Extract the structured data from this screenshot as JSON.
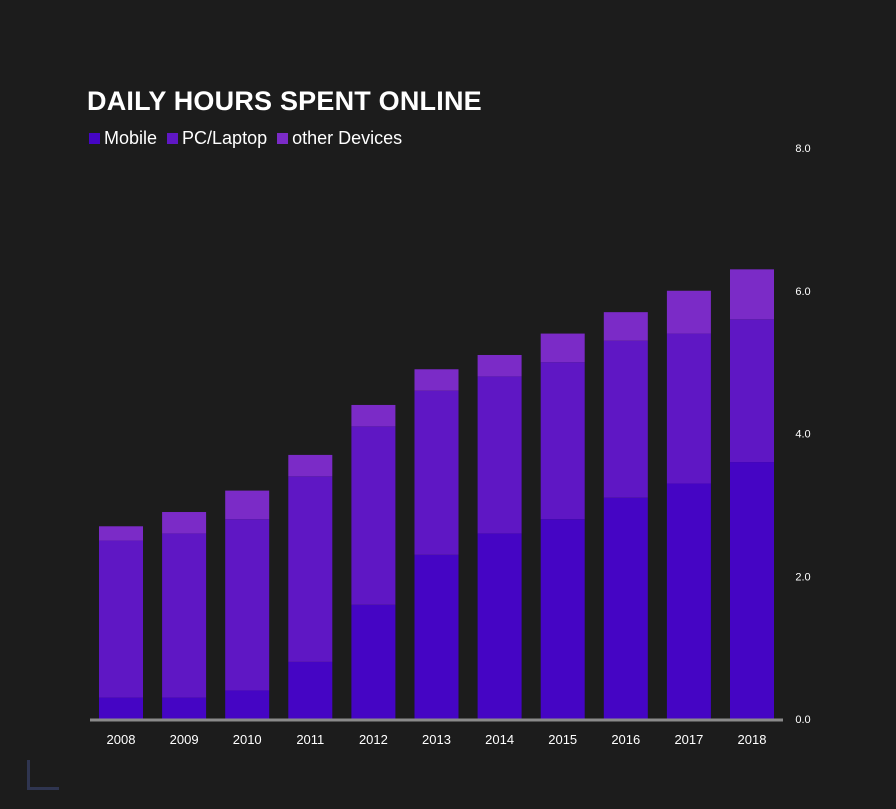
{
  "chart_data": {
    "type": "bar",
    "stacked": true,
    "title": "DAILY HOURS SPENT ONLINE",
    "xlabel": "",
    "ylabel": "",
    "categories": [
      "2008",
      "2009",
      "2010",
      "2011",
      "2012",
      "2013",
      "2014",
      "2015",
      "2016",
      "2017",
      "2018"
    ],
    "series": [
      {
        "name": "Mobile",
        "color": "#4505c4",
        "values": [
          0.3,
          0.3,
          0.4,
          0.8,
          1.6,
          2.3,
          2.6,
          2.8,
          3.1,
          3.3,
          3.6
        ]
      },
      {
        "name": "PC/Laptop",
        "color": "#5f17c4",
        "values": [
          2.2,
          2.3,
          2.4,
          2.6,
          2.5,
          2.3,
          2.2,
          2.2,
          2.2,
          2.1,
          2.0
        ]
      },
      {
        "name": "other Devices",
        "color": "#7b2bc7",
        "values": [
          0.2,
          0.3,
          0.4,
          0.3,
          0.3,
          0.3,
          0.3,
          0.4,
          0.4,
          0.6,
          0.7
        ]
      }
    ],
    "ylim": [
      0,
      8
    ],
    "yticks": [
      "0.0",
      "2.0",
      "4.0",
      "6.0",
      "8.0"
    ],
    "y_axis_position": "right",
    "grid": false,
    "legend_position": "top-left"
  }
}
